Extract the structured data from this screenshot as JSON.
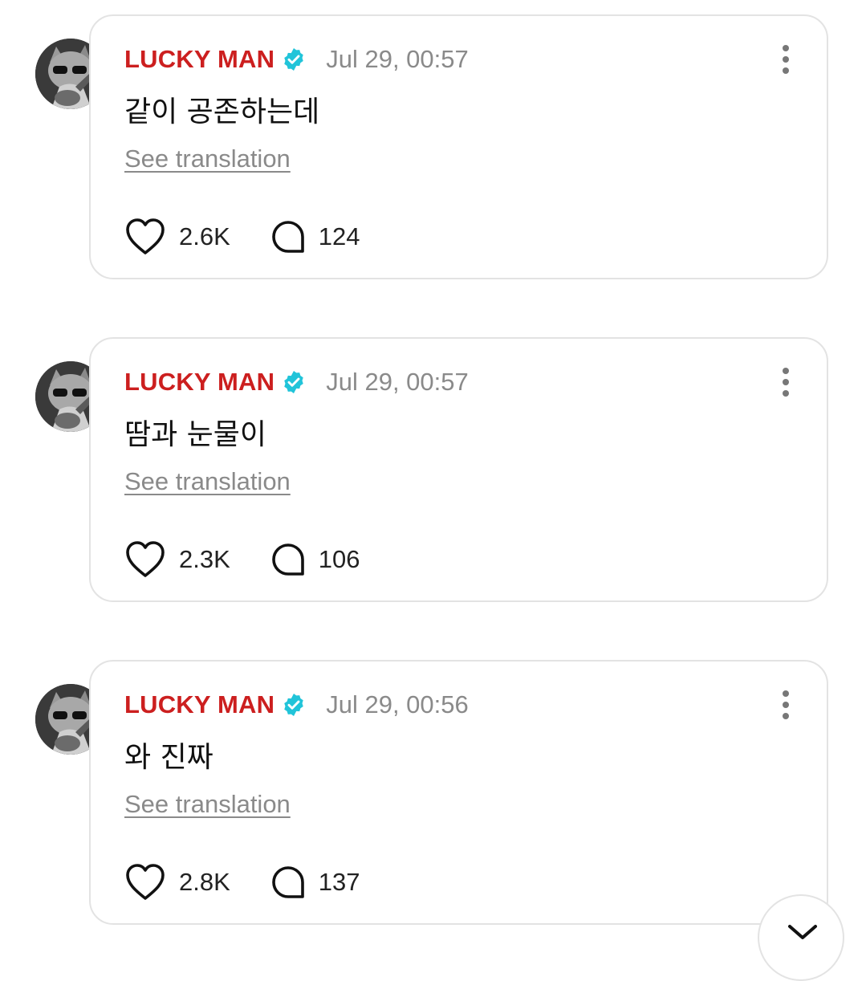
{
  "posts": [
    {
      "username": "LUCKY MAN",
      "timestamp": "Jul 29, 00:57",
      "text": "같이 공존하는데",
      "translate_label": "See translation",
      "likes": "2.6K",
      "comments": "124"
    },
    {
      "username": "LUCKY MAN",
      "timestamp": "Jul 29, 00:57",
      "text": "땀과 눈물이",
      "translate_label": "See translation",
      "likes": "2.3K",
      "comments": "106"
    },
    {
      "username": "LUCKY MAN",
      "timestamp": "Jul 29, 00:56",
      "text": "와 진짜",
      "translate_label": "See translation",
      "likes": "2.8K",
      "comments": "137"
    }
  ],
  "icons": {
    "verified": "verified-badge-icon",
    "more": "more-vertical-icon",
    "like": "heart-icon",
    "comment": "comment-bubble-icon",
    "scroll": "chevron-down-icon"
  },
  "colors": {
    "username": "#cc1f1f",
    "verified": "#21c4d9",
    "muted": "#8a8a8a",
    "border": "#e3e3e3"
  }
}
